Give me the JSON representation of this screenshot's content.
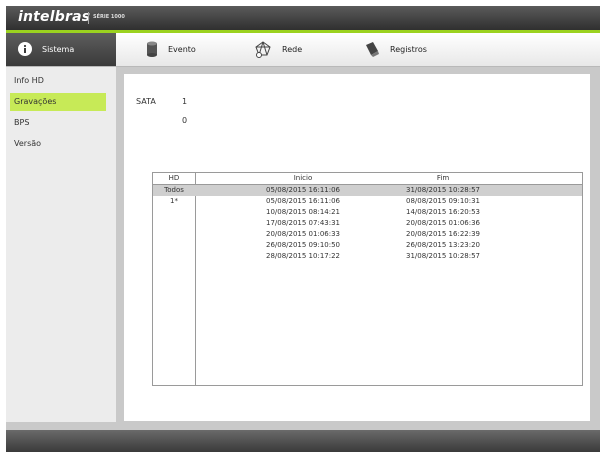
{
  "header": {
    "logo": "intelbras",
    "logo_sub": "SÉRIE 1000"
  },
  "tabs": [
    {
      "label": "Sistema",
      "icon": "info-icon"
    },
    {
      "label": "Evento",
      "icon": "cylinder-icon"
    },
    {
      "label": "Rede",
      "icon": "network-icon"
    },
    {
      "label": "Registros",
      "icon": "clipboard-icon"
    }
  ],
  "sidebar": {
    "items": [
      {
        "label": "Info HD"
      },
      {
        "label": "Gravações"
      },
      {
        "label": "BPS"
      },
      {
        "label": "Versão"
      }
    ]
  },
  "sata": {
    "label": "SATA",
    "value": "1",
    "second": "0"
  },
  "table": {
    "headers": {
      "hd": "HD",
      "inicio": "Inicio",
      "fim": "Fim"
    },
    "rows": [
      {
        "hd": "Todos",
        "inicio": "05/08/2015 16:11:06",
        "fim": "31/08/2015 10:28:57"
      },
      {
        "hd": "1*",
        "inicio": "05/08/2015 16:11:06",
        "fim": "08/08/2015 09:10:31"
      },
      {
        "hd": "",
        "inicio": "10/08/2015 08:14:21",
        "fim": "14/08/2015 16:20:53"
      },
      {
        "hd": "",
        "inicio": "17/08/2015 07:43:31",
        "fim": "20/08/2015 01:06:36"
      },
      {
        "hd": "",
        "inicio": "20/08/2015 01:06:33",
        "fim": "20/08/2015 16:22:39"
      },
      {
        "hd": "",
        "inicio": "26/08/2015 09:10:50",
        "fim": "26/08/2015 13:23:20"
      },
      {
        "hd": "",
        "inicio": "28/08/2015 10:17:22",
        "fim": "31/08/2015 10:28:57"
      }
    ]
  },
  "colors": {
    "accent": "#9bd21f",
    "active_item": "#c7ea57",
    "selected_row": "#cfcfcf"
  }
}
